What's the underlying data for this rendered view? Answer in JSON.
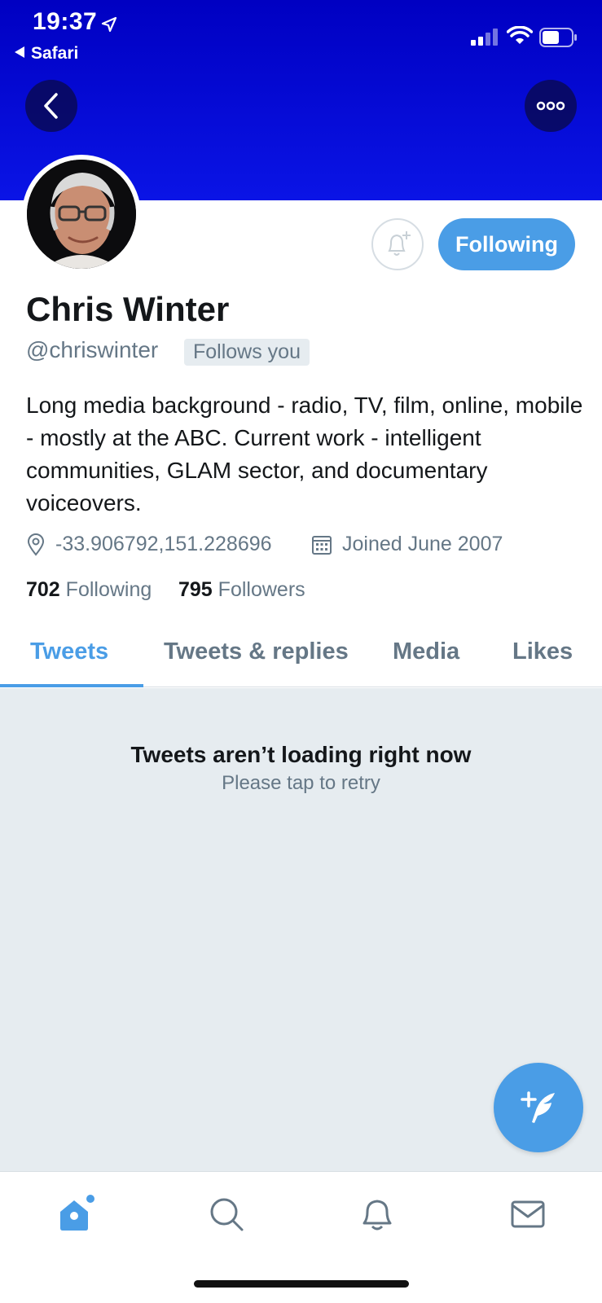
{
  "status_bar": {
    "time": "19:37",
    "back_app": "Safari"
  },
  "profile": {
    "name": "Chris Winter",
    "handle": "@chriswinter",
    "follows_you": "Follows you",
    "bio": "Long media background - radio, TV, film, online, mobile - mostly at the ABC. Current work - intelligent communities, GLAM sector, and documentary voiceovers.",
    "location": "-33.906792,151.228696",
    "joined": "Joined June 2007",
    "following_count": "702",
    "following_label": "Following",
    "followers_count": "795",
    "followers_label": "Followers",
    "following_button": "Following"
  },
  "tabs": [
    {
      "label": "Tweets",
      "active": true
    },
    {
      "label": "Tweets & replies",
      "active": false
    },
    {
      "label": "Media",
      "active": false
    },
    {
      "label": "Likes",
      "active": false
    }
  ],
  "content": {
    "error_title": "Tweets aren’t loading right now",
    "error_subtitle": "Please tap to retry"
  },
  "bottom_nav": [
    "home-icon",
    "search-icon",
    "notifications-icon",
    "messages-icon"
  ],
  "colors": {
    "accent": "#4a9de6",
    "banner": "#0000c2",
    "muted": "#657786",
    "background": "#e6ecf0"
  }
}
